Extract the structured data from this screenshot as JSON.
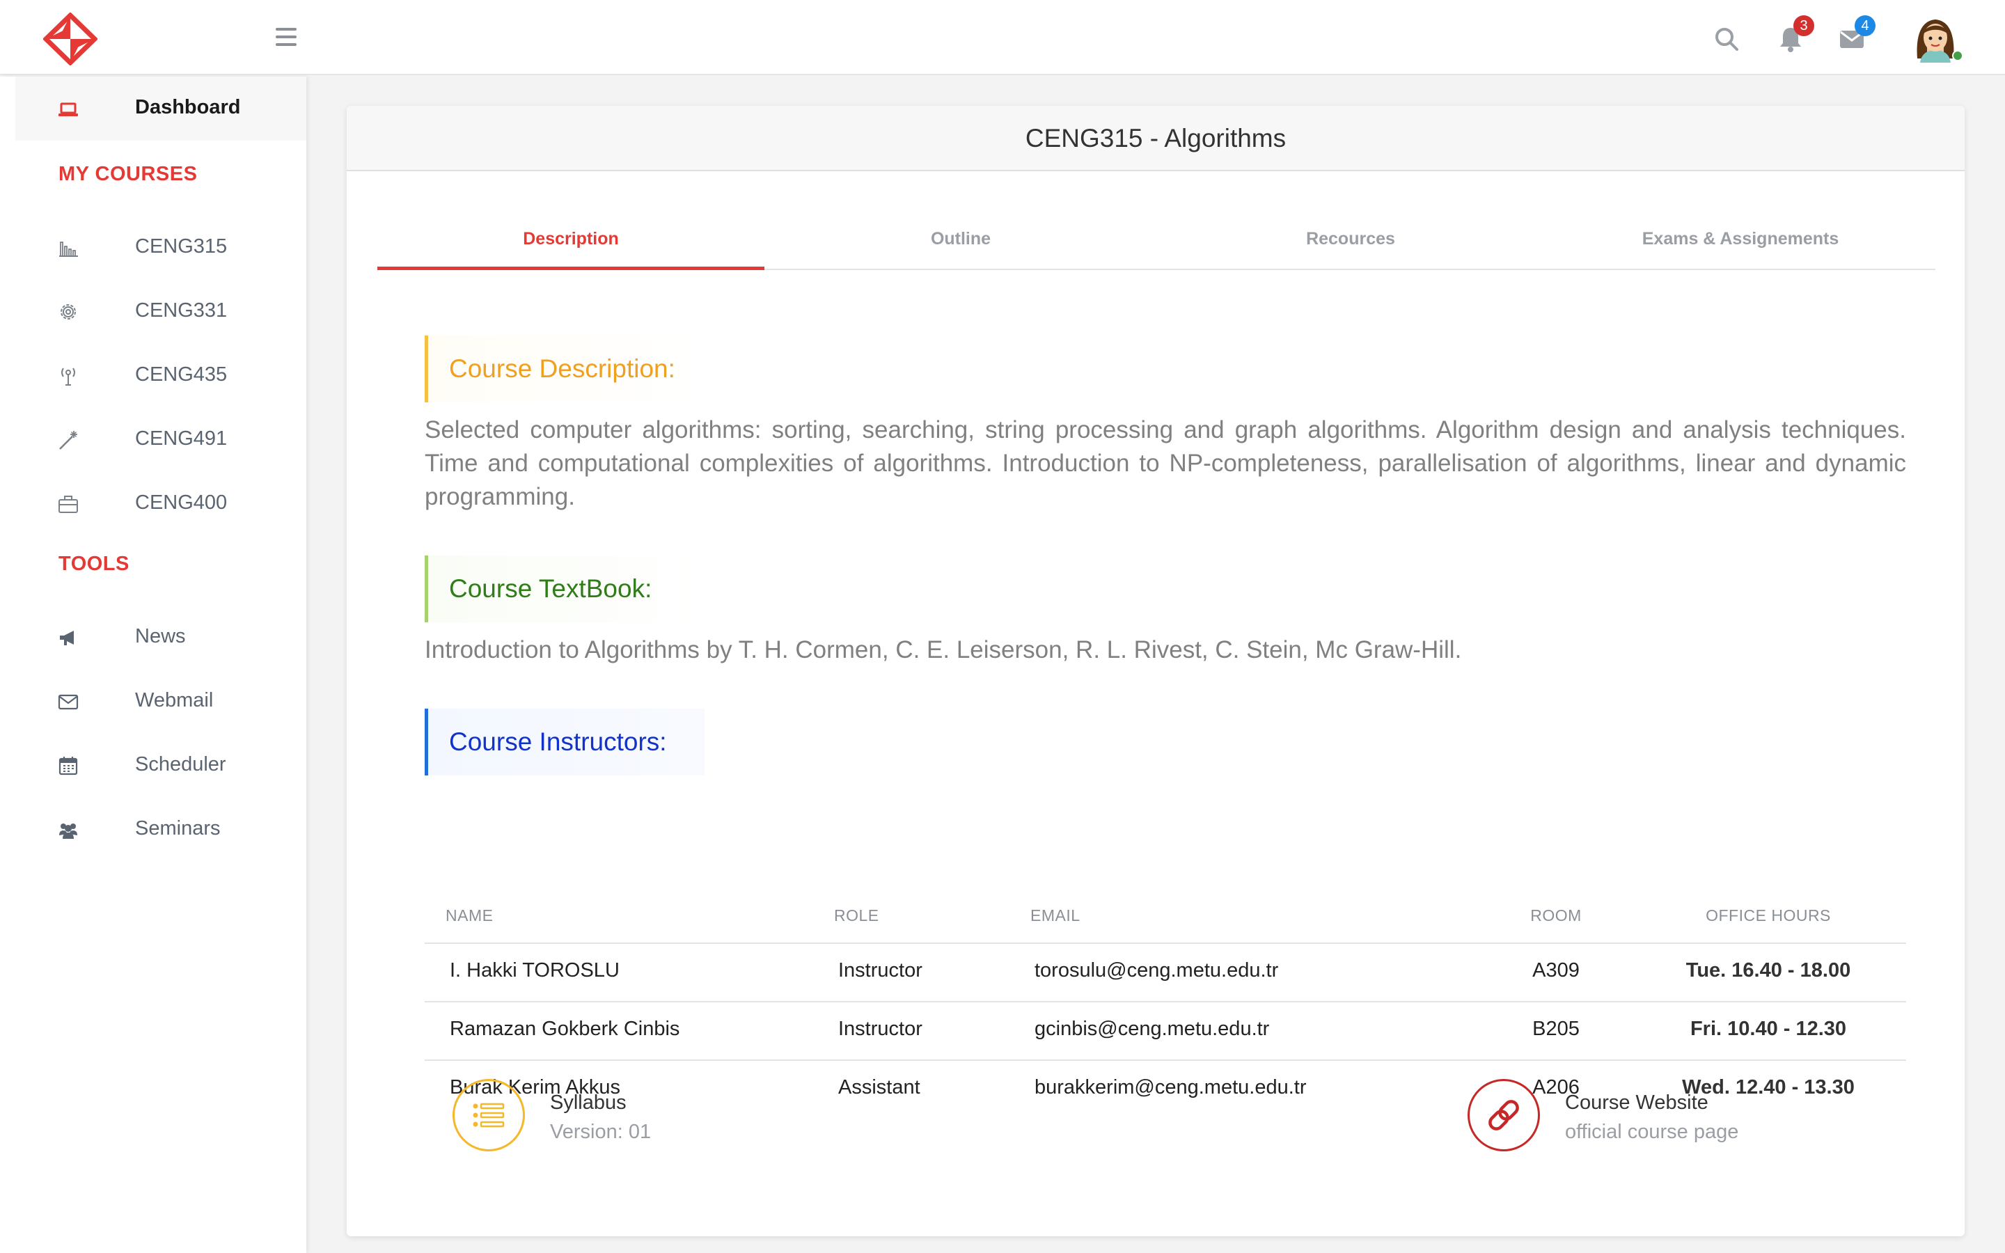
{
  "header": {
    "notification_count": "3",
    "message_count": "4"
  },
  "sidebar": {
    "dashboard_label": "Dashboard",
    "my_courses_title": "MY COURSES",
    "courses": [
      {
        "label": "CENG315",
        "icon": "bar-chart-icon"
      },
      {
        "label": "CENG331",
        "icon": "gear-icon"
      },
      {
        "label": "CENG435",
        "icon": "antenna-icon"
      },
      {
        "label": "CENG491",
        "icon": "magic-wand-icon"
      },
      {
        "label": "CENG400",
        "icon": "briefcase-icon"
      }
    ],
    "tools_title": "TOOLS",
    "tools": [
      {
        "label": "News",
        "icon": "megaphone-icon"
      },
      {
        "label": "Webmail",
        "icon": "envelope-icon"
      },
      {
        "label": "Scheduler",
        "icon": "calendar-icon"
      },
      {
        "label": "Seminars",
        "icon": "users-icon"
      }
    ]
  },
  "main": {
    "title": "CENG315 - Algorithms",
    "tabs": [
      "Description",
      "Outline",
      "Recources",
      "Exams & Assignements"
    ],
    "active_tab": "Description",
    "description_heading": "Course Description:",
    "description_text": "Selected computer algorithms: sorting, searching, string processing and graph algorithms. Algorithm design and analysis techniques. Time and computational complexities of algorithms. Introduction to NP-completeness, parallelisation of algorithms, linear and dynamic programming.",
    "textbook_heading": "Course TextBook:",
    "textbook_text": "Introduction to Algorithms by T. H. Cormen, C. E. Leiserson, R. L. Rivest, C. Stein, Mc Graw-Hill.",
    "instructors_heading": "Course Instructors:",
    "instructors_table": {
      "columns": [
        "NAME",
        "ROLE",
        "EMAIL",
        "ROOM",
        "OFFICE HOURS"
      ],
      "rows": [
        [
          "I. Hakki TOROSLU",
          "Instructor",
          "torosulu@ceng.metu.edu.tr",
          "A309",
          "Tue. 16.40 - 18.00"
        ],
        [
          "Ramazan Gokberk Cinbis",
          "Instructor",
          "gcinbis@ceng.metu.edu.tr",
          "B205",
          "Fri. 10.40 - 12.30"
        ],
        [
          "Burak Kerim Akkus",
          "Assistant",
          "burakkerim@ceng.metu.edu.tr",
          "A206",
          "Wed. 12.40 - 13.30"
        ]
      ]
    },
    "syllabus": {
      "title": "Syllabus",
      "subtitle": "Version: 01",
      "icon": "list-icon"
    },
    "website": {
      "title": "Course Website",
      "subtitle": "official course page",
      "icon": "link-icon"
    }
  },
  "colors": {
    "accent_red": "#e53935",
    "description_yellow": "#f0a020",
    "textbook_green": "#2e7d16",
    "instructors_blue": "#1133cc"
  }
}
